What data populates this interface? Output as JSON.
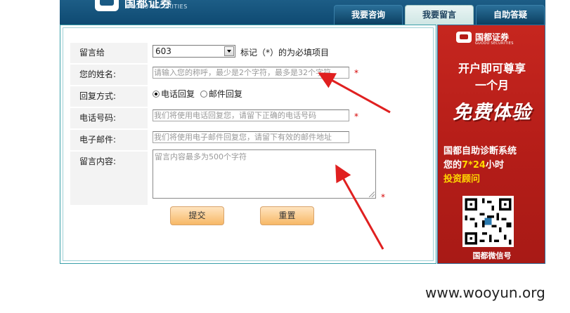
{
  "header": {
    "logo_cn": "国都证券",
    "logo_en": "GUODU SECURITIES",
    "tabs": [
      {
        "label": "我要咨询"
      },
      {
        "label": "我要留言",
        "active": true
      },
      {
        "label": "自助答疑"
      }
    ]
  },
  "form": {
    "recipient_label": "留言给",
    "recipient_value": "603",
    "required_note": "标记（*）的为必填项目",
    "name_label": "您的姓名:",
    "name_placeholder": "请输入您的称呼，最少是2个字符，最多是32个字符",
    "reply_label": "回复方式:",
    "reply_options": [
      {
        "label": "电话回复",
        "checked": true
      },
      {
        "label": "邮件回复",
        "checked": false
      }
    ],
    "phone_label": "电话号码:",
    "phone_placeholder": "我们将使用电话回复您，请留下正确的电话号码",
    "email_label": "电子邮件:",
    "email_placeholder": "我们将使用电子邮件回复您，请留下有效的邮件地址",
    "content_label": "留言内容:",
    "content_placeholder": "留言内容最多为500个字符",
    "required_mark": "*",
    "submit_label": "提交",
    "reset_label": "重置"
  },
  "ad": {
    "logo_cn": "国都证券",
    "logo_en": "GUODU SECURITIES",
    "line1": "开户即可尊享",
    "line2": "一个月",
    "free": "免费体验",
    "diag_line1": "国都自助诊断系统",
    "diag_prefix": "您的",
    "diag_hours": "7*24",
    "diag_suffix": "小时",
    "diag_line3": "投资顾问",
    "wechat": "国都微信号"
  },
  "watermark": "www.wooyun.org",
  "colors": {
    "header": "#0e4a72",
    "ad_bg": "#b41d18",
    "arrow": "#e02020",
    "required": "#d50000"
  }
}
